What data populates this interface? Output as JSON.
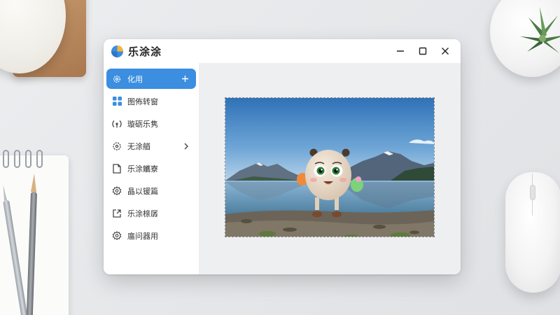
{
  "app": {
    "title": "乐涂涂"
  },
  "window_controls": {
    "minimize": "minimize",
    "maximize": "maximize",
    "close": "close"
  },
  "sidebar": {
    "items": [
      {
        "label": "化用",
        "icon": "gear-icon",
        "active": true,
        "trail": "plus-icon"
      },
      {
        "label": "图佈转窗",
        "icon": "grid-icon",
        "active": false
      },
      {
        "label": "璇砺乐隽",
        "icon": "signal-icon",
        "active": false
      },
      {
        "label": "无涂艏",
        "icon": "dashed-gear-icon",
        "active": false,
        "trail": "chevron-right-icon"
      },
      {
        "label": "乐涂觿寮",
        "icon": "document-icon",
        "active": false
      },
      {
        "label": "晶以锾篇",
        "icon": "settings-icon",
        "active": false
      },
      {
        "label": "乐涂榇孱",
        "icon": "export-icon",
        "active": false
      },
      {
        "label": "庿问器用",
        "icon": "settings-icon",
        "active": false
      }
    ]
  },
  "colors": {
    "accent": "#3b8ee0",
    "window_bg": "#ffffff",
    "content_bg": "#eeeff1"
  }
}
